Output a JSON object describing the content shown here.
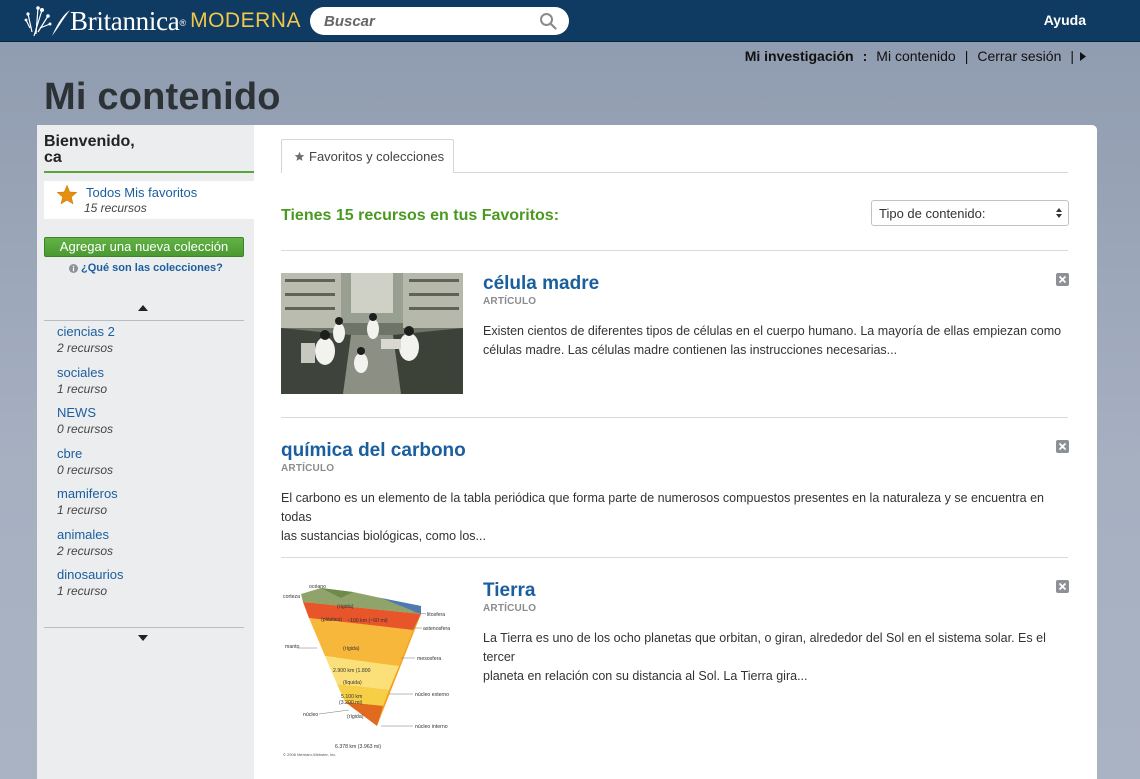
{
  "header": {
    "brand": "Britannica",
    "brand_reg": "®",
    "brand_sub": "MODERNA",
    "search_placeholder": "Buscar",
    "help": "Ayuda"
  },
  "usernav": {
    "research": "Mi investigación",
    "colon": ":",
    "my_content": "Mi contenido",
    "sep": "|",
    "logout": "Cerrar sesión",
    "sep2": "|"
  },
  "page_title": "Mi contenido",
  "sidebar": {
    "welcome_line1": "Bienvenido,",
    "welcome_line2": "ca",
    "all_favorites": "Todos Mis favoritos",
    "all_favorites_count": "15 recursos",
    "add_collection": "Agregar una nueva colección",
    "what_collections": "¿Qué son las colecciones?",
    "collections": [
      {
        "name": "ciencias 2",
        "count": "2 recursos"
      },
      {
        "name": "sociales",
        "count": "1 recurso"
      },
      {
        "name": "NEWS",
        "count": "0 recursos"
      },
      {
        "name": "cbre",
        "count": "0 recursos"
      },
      {
        "name": "mamiferos",
        "count": "1 recurso"
      },
      {
        "name": "animales",
        "count": "2 recursos"
      },
      {
        "name": "dinosaurios",
        "count": "1 recurso"
      }
    ]
  },
  "main": {
    "tab_label": "Favoritos y colecciones",
    "summary": "Tienes 15 recursos en tus Favoritos:",
    "type_select": "Tipo de contenido:",
    "results": [
      {
        "title": "célula madre",
        "type": "ARTÍCULO",
        "desc1": "Existen cientos de diferentes tipos de células en el cuerpo humano. La mayoría de ellas empiezan como",
        "desc2": "células madre. Las células madre contienen las instrucciones necesarias..."
      },
      {
        "title": "química del carbono",
        "type": "ARTÍCULO",
        "desc1": "El carbono es un elemento de la tabla periódica que forma parte de numerosos compuestos presentes en la naturaleza y se encuentra en todas",
        "desc2": "las sustancias biológicas, como los..."
      },
      {
        "title": "Tierra",
        "type": "ARTÍCULO",
        "desc1": "La Tierra es uno de los ocho planetas que orbitan, o giran, alrededor del Sol en el sistema solar. Es el tercer",
        "desc2": "planeta en relación con su distancia al Sol. La Tierra gira..."
      }
    ],
    "earth_diagram": {
      "oceano": "océano",
      "corteza": "corteza",
      "rigida_top": "(rígida)",
      "plastica": "(plástica)",
      "depth_100": "~100 km (~60 mi)",
      "litosfera": "litosfera",
      "astenosfera": "astenosfera",
      "manto": "manto",
      "rigida_mid": "(rígida)",
      "mesosfera": "mesosfera",
      "depth_2900": "2.900 km (1.800",
      "liquida": "(líquida)",
      "nucleo_externo": "núcleo externo",
      "depth_5100a": "5.100 km",
      "depth_5100b": "(3.200 mi)",
      "nucleo": "núcleo",
      "rigida_bot": "(rígida)",
      "nucleo_interno": "núcleo interno",
      "depth_6378": "6.378 km (3.963 mi)",
      "copyright": "© 2006 Merriam-Webster, Inc."
    }
  }
}
